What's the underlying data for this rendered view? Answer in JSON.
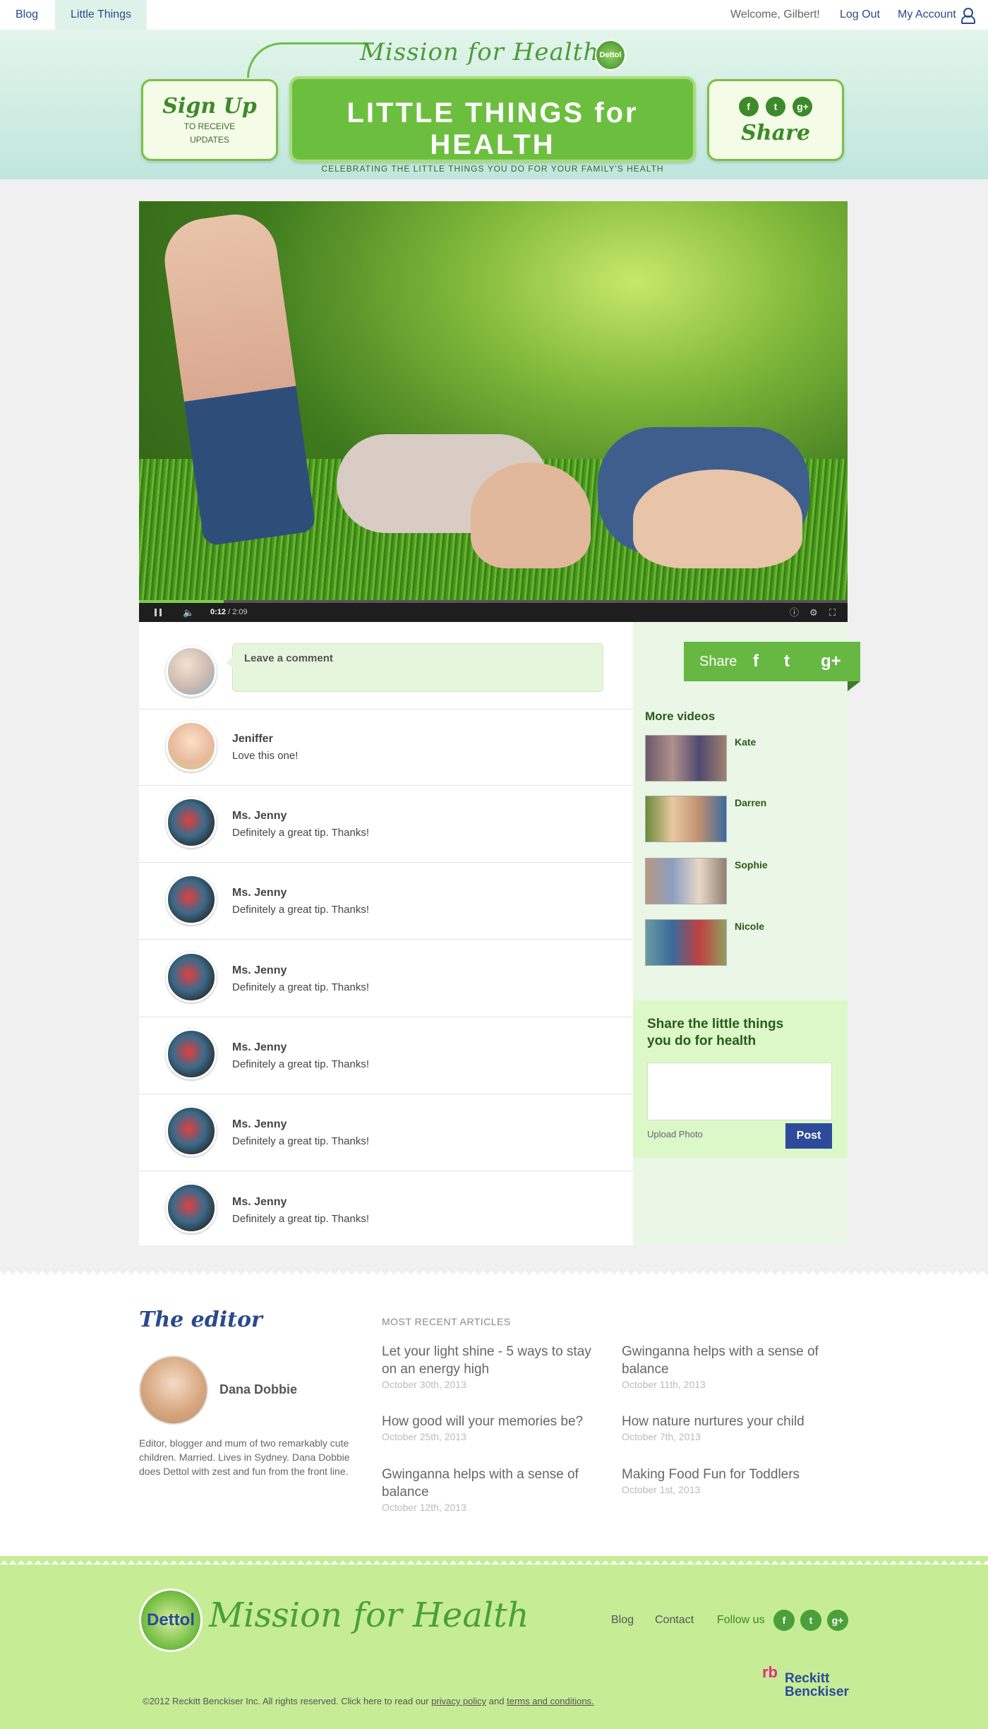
{
  "topnav": {
    "tabs": [
      "Blog",
      "Little Things"
    ],
    "welcome": "Welcome, Gilbert!",
    "logout": "Log Out",
    "account": "My Account"
  },
  "header": {
    "brand": "Mission for Health",
    "badge": "Dettol",
    "signup_script": "Sign Up",
    "signup_small_1": "TO RECEIVE",
    "signup_small_2": "UPDATES",
    "title": "LITTLE THINGS for HEALTH",
    "subtitle": "CELEBRATING THE LITTLE THINGS YOU DO FOR YOUR FAMILY'S HEALTH",
    "share_script": "Share",
    "share_icons": [
      "f",
      "t",
      "g+"
    ]
  },
  "video": {
    "current_time": "0:12",
    "duration": "/ 2:09",
    "progress": 0.12
  },
  "comments": {
    "placeholder": "Leave a comment",
    "items": [
      {
        "name": "Jeniffer",
        "text": "Love this one!"
      },
      {
        "name": "Ms. Jenny",
        "text": "Definitely a great tip. Thanks!"
      },
      {
        "name": "Ms. Jenny",
        "text": "Definitely a great tip. Thanks!"
      },
      {
        "name": "Ms. Jenny",
        "text": "Definitely a great tip. Thanks!"
      },
      {
        "name": "Ms. Jenny",
        "text": "Definitely a great tip. Thanks!"
      },
      {
        "name": "Ms. Jenny",
        "text": "Definitely a great tip. Thanks!"
      },
      {
        "name": "Ms. Jenny",
        "text": "Definitely a great tip. Thanks!"
      }
    ]
  },
  "sidebar": {
    "share_label": "Share",
    "more_videos_title": "More videos",
    "videos": [
      "Kate",
      "Darren",
      "Sophie",
      "Nicole"
    ],
    "share_form_title": "Share the little things you do for health",
    "upload_label": "Upload Photo",
    "post_label": "Post"
  },
  "editor": {
    "title": "The editor",
    "name": "Dana Dobbie",
    "bio": "Editor, blogger and mum of two remarkably cute children. Married. Lives in Sydney. Dana Dobbie does Dettol with zest and fun from the front line."
  },
  "articles": {
    "heading": "MOST RECENT ARTICLES",
    "items": [
      {
        "title": "Let your light shine - 5 ways to stay on an energy high",
        "date": "October 30th, 2013"
      },
      {
        "title": "Gwinganna helps with a sense of balance",
        "date": "October 11th, 2013"
      },
      {
        "title": "How good will your memories be?",
        "date": "October 25th, 2013"
      },
      {
        "title": "How nature nurtures your child",
        "date": "October 7th, 2013"
      },
      {
        "title": "Gwinganna helps with a sense of balance",
        "date": "October 12th, 2013"
      },
      {
        "title": "Making Food Fun for Toddlers",
        "date": "October 1st, 2013"
      }
    ]
  },
  "footer": {
    "logo_text": "Dettol",
    "brand": "Mission for Health",
    "links": [
      "Blog",
      "Contact"
    ],
    "follow": "Follow us",
    "social": [
      "f",
      "t",
      "g+"
    ],
    "rb_line1": "Reckitt",
    "rb_line2": "Benckiser",
    "copyright_pre": "©2012 Reckitt Benckiser Inc. All rights reserved. Click here to read our ",
    "privacy": "privacy policy",
    "and": " and ",
    "terms": "terms and conditions."
  },
  "colors": {
    "accent_green": "#66b843",
    "navy": "#2a4a8a",
    "post_button": "#2e4a9a"
  }
}
